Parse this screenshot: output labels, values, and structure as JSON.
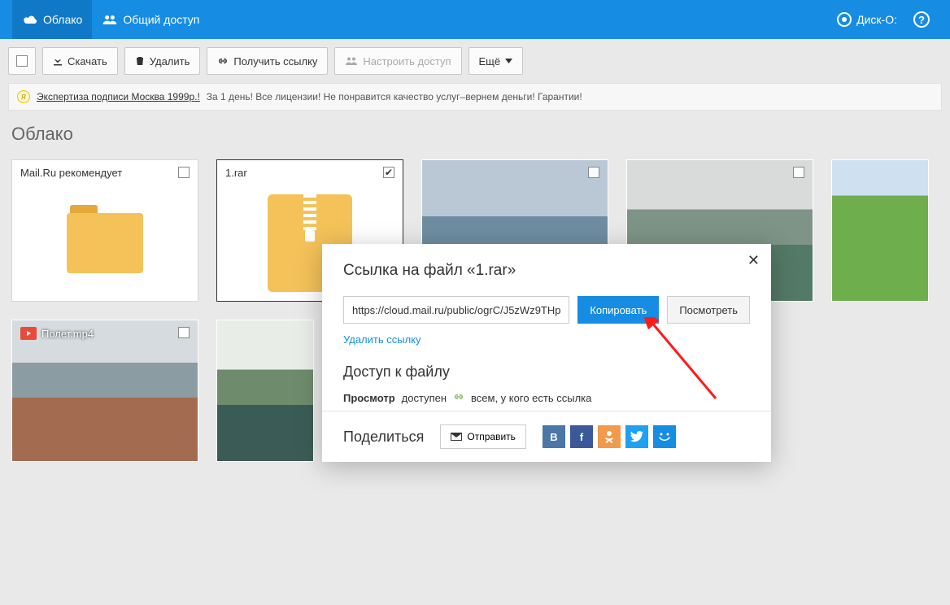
{
  "nav": {
    "cloud": "Облако",
    "shared": "Общий доступ",
    "disko": "Диск-О:"
  },
  "toolbar": {
    "download": "Скачать",
    "delete": "Удалить",
    "getlink": "Получить ссылку",
    "configure": "Настроить доступ",
    "more": "Ещё"
  },
  "ad": {
    "link": "Экспертиза подписи Москва 1999р.!",
    "text": "За 1 день! Все лицензии! Не понравится качество услуг–вернем деньги! Гарантии!"
  },
  "page": {
    "title": "Облако"
  },
  "tiles": {
    "recommend": "Mail.Ru рекомендует",
    "rar": "1.rar",
    "video": "Полет.mp4"
  },
  "modal": {
    "title": "Ссылка на файл «1.rar»",
    "url": "https://cloud.mail.ru/public/ogrC/J5zWz9THp",
    "copy": "Копировать",
    "view": "Посмотреть",
    "delete_link": "Удалить ссылку",
    "access_title": "Доступ к файлу",
    "access_view": "Просмотр",
    "access_available": "доступен",
    "access_who": "всем, у кого есть ссылка",
    "share_title": "Поделиться",
    "send": "Отправить"
  },
  "social": {
    "vk": "B",
    "fb": "f",
    "ok": "o",
    "tw": "t",
    "mm": ":)"
  }
}
